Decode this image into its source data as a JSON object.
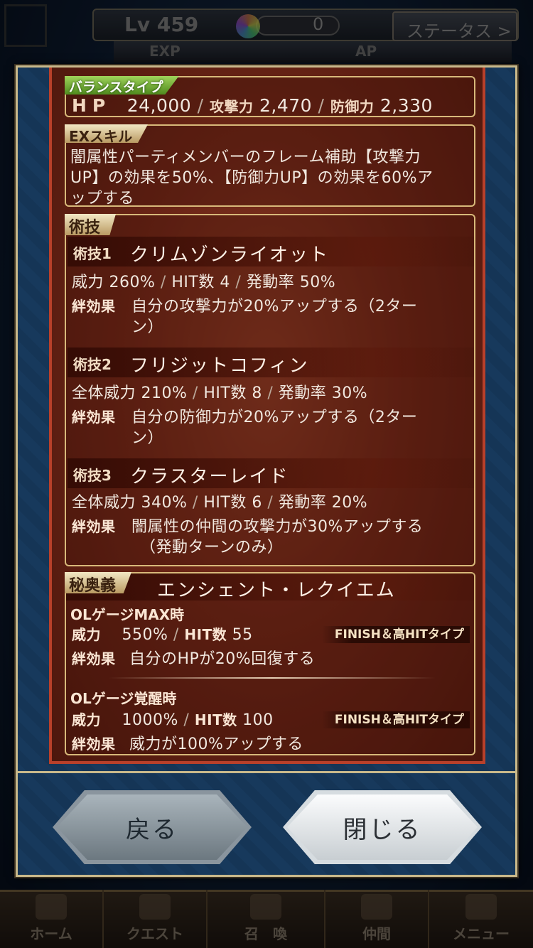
{
  "hud": {
    "level_label": "Lv 459",
    "gem_count": "0",
    "status_button": "ステータス >",
    "exp_label": "EXP",
    "ap_label": "AP"
  },
  "nav": [
    {
      "label": "ホーム",
      "icon": "home-icon"
    },
    {
      "label": "クエスト",
      "icon": "map-icon"
    },
    {
      "label": "召　喚",
      "icon": "summon-icon"
    },
    {
      "label": "仲間",
      "icon": "party-icon"
    },
    {
      "label": "メニュー",
      "icon": "menu-icon"
    }
  ],
  "stats": {
    "type_tag": "バランスタイプ",
    "hp_label": "HP",
    "hp_value": "24,000",
    "atk_label": "攻撃力",
    "atk_value": "2,470",
    "def_label": "防御力",
    "def_value": "2,330",
    "sep": "/"
  },
  "ex_skill": {
    "tag": "EXスキル",
    "line1": "闇属性パーティメンバーのフレーム補助【攻撃力",
    "line2": "UP】の効果を50%、【防御力UP】の効果を60%ア",
    "line3": "ップする"
  },
  "arts": {
    "tag": "術技",
    "effect_label": "絆効果",
    "items": [
      {
        "no": "術技1",
        "name": "クリムゾンライオット",
        "power_label": "威力",
        "power": "260%",
        "hit_label": "HIT数",
        "hit": "4",
        "rate_label": "発動率",
        "rate": "50%",
        "effect1": "自分の攻撃力が20%アップする（2ター",
        "effect2": "ン）"
      },
      {
        "no": "術技2",
        "name": "フリジットコフィン",
        "power_label": "全体威力",
        "power": "210%",
        "hit_label": "HIT数",
        "hit": "8",
        "rate_label": "発動率",
        "rate": "30%",
        "effect1": "自分の防御力が20%アップする（2ター",
        "effect2": "ン）"
      },
      {
        "no": "術技3",
        "name": "クラスターレイド",
        "power_label": "全体威力",
        "power": "340%",
        "hit_label": "HIT数",
        "hit": "6",
        "rate_label": "発動率",
        "rate": "20%",
        "effect1": "闇属性の仲間の攻撃力が30%アップする",
        "effect2": "（発動ターンのみ）"
      }
    ]
  },
  "mystic": {
    "tag": "秘奥義",
    "name": "エンシェント・レクイエム",
    "max": {
      "heading": "OLゲージMAX時",
      "power_label": "威力",
      "power": "550%",
      "hit_label": "HIT数",
      "hit": "55",
      "type": "FINISH＆高HITタイプ",
      "effect_label": "絆効果",
      "effect": "自分のHPが20%回復する"
    },
    "awake": {
      "heading": "OLゲージ覚醒時",
      "power_label": "威力",
      "power": "1000%",
      "hit_label": "HIT数",
      "hit": "100",
      "type": "FINISH＆高HITタイプ",
      "effect_label": "絆効果",
      "effect": "威力が100%アップする"
    }
  },
  "buttons": {
    "back": "戻る",
    "close": "閉じる"
  }
}
